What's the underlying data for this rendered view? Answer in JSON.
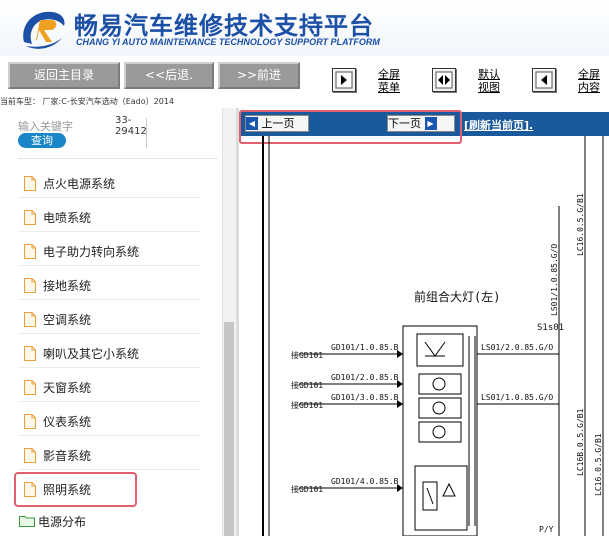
{
  "header": {
    "title_cn": "畅易汽车维修技术支持平台",
    "title_en": "CHANG YI AUTO MAINTENANCE TECHNOLOGY SUPPORT PLATFORM"
  },
  "toolbar": {
    "home_label": "返回主目录",
    "back_label": "<<后退.",
    "forward_label": ">>前进",
    "fullscreen_menu_label_1": "全屏",
    "fullscreen_menu_label_2": "菜单",
    "default_view_label_1": "默认",
    "default_view_label_2": "视图",
    "fullscreen_content_label_1": "全屏",
    "fullscreen_content_label_2": "内容"
  },
  "info": {
    "current_vehicle": "当前车型： 厂家:C-长安汽车选动（Eado）2014"
  },
  "search": {
    "placeholder": "输入关键字",
    "button_label": "查询",
    "code": "33-29412"
  },
  "menu": {
    "items": [
      {
        "label": "点火电源系统"
      },
      {
        "label": "电喷系统"
      },
      {
        "label": "电子助力转向系统"
      },
      {
        "label": "接地系统"
      },
      {
        "label": "空调系统"
      },
      {
        "label": "喇叭及其它小系统"
      },
      {
        "label": "天窗系统"
      },
      {
        "label": "仪表系统"
      },
      {
        "label": "影音系统"
      },
      {
        "label": "照明系统"
      }
    ],
    "folder": {
      "label": "电源分布"
    }
  },
  "pager": {
    "prev_label": "上一页",
    "next_label": "下一页",
    "refresh_label": "[刷新当前页]."
  },
  "diagram": {
    "component_title": "前组合大灯(左)",
    "connector_label": "S1s01",
    "wire_labels": [
      {
        "label": "GD101/1.0.85.B",
        "conn": "接GD101"
      },
      {
        "label": "GD101/2.0.85.B",
        "conn": "接GD101"
      },
      {
        "label": "GD101/3.0.85.B",
        "conn": "接GD101"
      },
      {
        "label": "GD101/4.0.85.B",
        "conn": "接GD101"
      }
    ],
    "right_wire_labels": [
      "LS01/2.0.85.G/O",
      "LS01/1.0.85.G/O"
    ],
    "vertical_labels": [
      "LS01/1.0.85.G/O",
      "LC16.0.5.G/B1",
      "LC16B.0.5.G/B1",
      "LC16.0.5.G/B1"
    ],
    "bottom_partial": "P/Y"
  },
  "colors": {
    "brand_blue": "#1c4fa6",
    "pager_bar": "#1a5a9c",
    "search_button": "#1a86c8",
    "highlight": "#e06070"
  }
}
